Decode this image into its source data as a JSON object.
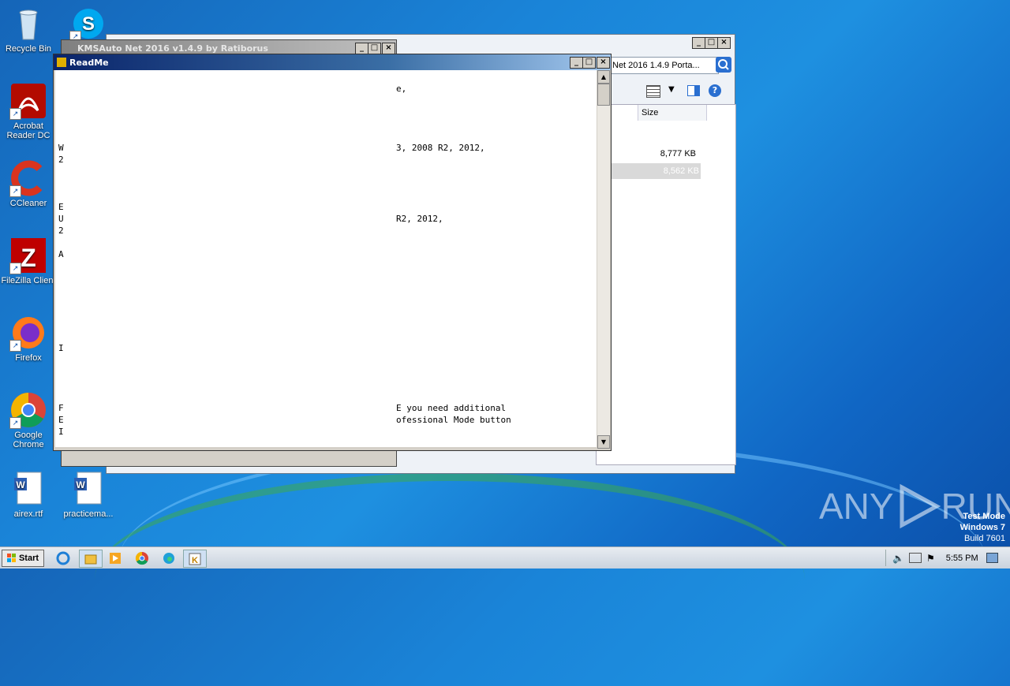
{
  "desktop_icons": [
    {
      "label": "Recycle Bin",
      "icon": "recycle-bin-icon"
    },
    {
      "label": "Acrobat Reader DC",
      "icon": "acrobat-icon"
    },
    {
      "label": "CCleaner",
      "icon": "ccleaner-icon"
    },
    {
      "label": "FileZilla Client",
      "icon": "filezilla-icon"
    },
    {
      "label": "Firefox",
      "icon": "firefox-icon"
    },
    {
      "label": "Google Chrome",
      "icon": "chrome-icon"
    },
    {
      "label": "airex.rtf",
      "icon": "word-doc-icon"
    },
    {
      "label": "practicema...",
      "icon": "word-doc-icon"
    }
  ],
  "explorer": {
    "address": "Net 2016 1.4.9 Porta...",
    "column_size": "Size",
    "files": [
      {
        "size": "8,777 KB"
      },
      {
        "size": "8,562 KB"
      }
    ]
  },
  "kms_window": {
    "title": "KMSAuto Net 2016 v1.4.9 by Ratiborus"
  },
  "readme": {
    "title": "ReadMe",
    "lines": [
      {
        "text": "e,"
      },
      {
        "text": "W",
        "right": "3, 2008 R2, 2012,"
      },
      {
        "text": "2"
      },
      {
        "text": "E"
      },
      {
        "text": "U",
        "right": "R2, 2012,"
      },
      {
        "text": "2"
      },
      {
        "text": "A"
      },
      {
        "text": "I"
      },
      {
        "text": "F",
        "right": "E you need additional"
      },
      {
        "text": "E",
        "right": "ofessional Mode button"
      },
      {
        "text": "I"
      }
    ]
  },
  "watermark": {
    "brand": "ANY",
    "brand2": "RUN"
  },
  "os_info": {
    "mode": "Test Mode",
    "os": "Windows 7",
    "build": "Build 7601"
  },
  "taskbar": {
    "start_label": "Start",
    "clock": "5:55 PM"
  }
}
